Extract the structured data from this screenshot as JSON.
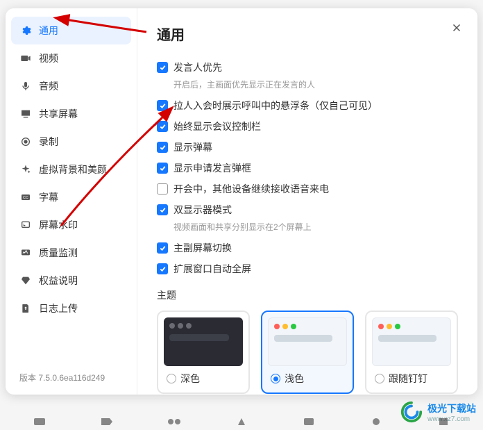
{
  "sidebar": {
    "items": [
      {
        "label": "通用",
        "icon": "gear-icon",
        "active": true
      },
      {
        "label": "视频",
        "icon": "video-icon",
        "active": false
      },
      {
        "label": "音频",
        "icon": "microphone-icon",
        "active": false
      },
      {
        "label": "共享屏幕",
        "icon": "screen-share-icon",
        "active": false
      },
      {
        "label": "录制",
        "icon": "record-icon",
        "active": false
      },
      {
        "label": "虚拟背景和美颜",
        "icon": "sparkle-icon",
        "active": false
      },
      {
        "label": "字幕",
        "icon": "subtitle-icon",
        "active": false
      },
      {
        "label": "屏幕水印",
        "icon": "watermark-icon",
        "active": false
      },
      {
        "label": "质量监测",
        "icon": "monitor-icon",
        "active": false
      },
      {
        "label": "权益说明",
        "icon": "diamond-icon",
        "active": false
      },
      {
        "label": "日志上传",
        "icon": "upload-log-icon",
        "active": false
      }
    ]
  },
  "version": "版本 7.5.0.6ea116d249",
  "main": {
    "title": "通用",
    "options": [
      {
        "label": "发言人优先",
        "checked": true,
        "desc": "开启后，主画面优先显示正在发言的人"
      },
      {
        "label": "拉人入会时展示呼叫中的悬浮条（仅自己可见）",
        "checked": true
      },
      {
        "label": "始终显示会议控制栏",
        "checked": true
      },
      {
        "label": "显示弹幕",
        "checked": true
      },
      {
        "label": "显示申请发言弹框",
        "checked": true
      },
      {
        "label": "开会中，其他设备继续接收语音来电",
        "checked": false
      },
      {
        "label": "双显示器模式",
        "checked": true,
        "desc": "视频画面和共享分别显示在2个屏幕上"
      },
      {
        "label": "主副屏幕切换",
        "checked": true
      },
      {
        "label": "扩展窗口自动全屏",
        "checked": true
      }
    ],
    "themeSection": {
      "label": "主题",
      "choices": [
        {
          "label": "深色",
          "variant": "dark",
          "selected": false
        },
        {
          "label": "浅色",
          "variant": "light",
          "selected": true
        },
        {
          "label": "跟随钉钉",
          "variant": "follow",
          "selected": false
        }
      ]
    }
  },
  "watermark": {
    "name": "极光下载站",
    "sub": "www.xz7.com"
  }
}
